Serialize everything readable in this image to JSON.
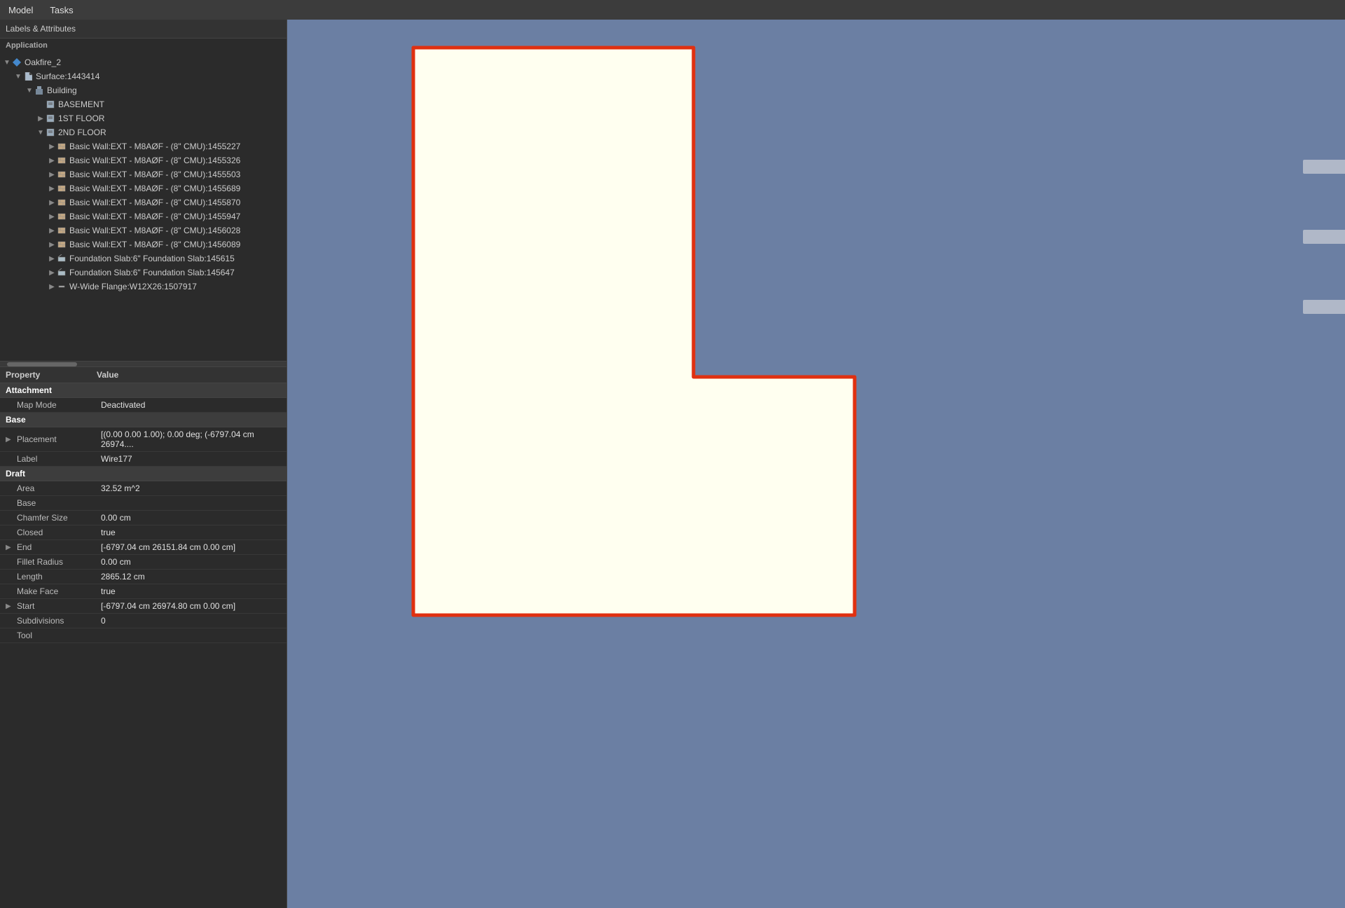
{
  "menubar": {
    "items": [
      "Model",
      "Tasks"
    ]
  },
  "panel": {
    "header": "Labels & Attributes",
    "section": "Application"
  },
  "tree": {
    "items": [
      {
        "id": "oakfire2",
        "label": "Oakfire_2",
        "indent": 0,
        "toggle": "▼",
        "icon": "🔷",
        "selected": false
      },
      {
        "id": "surface",
        "label": "Surface:1443414",
        "indent": 1,
        "toggle": "▼",
        "icon": "📄",
        "selected": false
      },
      {
        "id": "building",
        "label": "Building",
        "indent": 2,
        "toggle": "▼",
        "icon": "🏢",
        "selected": false
      },
      {
        "id": "basement",
        "label": "BASEMENT",
        "indent": 3,
        "toggle": " ",
        "icon": "📋",
        "selected": false
      },
      {
        "id": "1stfloor",
        "label": "1ST FLOOR",
        "indent": 3,
        "toggle": "▶",
        "icon": "📋",
        "selected": false
      },
      {
        "id": "2ndfloor",
        "label": "2ND FLOOR",
        "indent": 3,
        "toggle": "▼",
        "icon": "📋",
        "selected": false
      },
      {
        "id": "wall1",
        "label": "Basic Wall:EXT - M8AØF - (8\" CMU):1455227",
        "indent": 4,
        "toggle": "▶",
        "icon": "🧱",
        "selected": false
      },
      {
        "id": "wall2",
        "label": "Basic Wall:EXT - M8AØF - (8\" CMU):1455326",
        "indent": 4,
        "toggle": "▶",
        "icon": "🧱",
        "selected": false
      },
      {
        "id": "wall3",
        "label": "Basic Wall:EXT - M8AØF - (8\" CMU):1455503",
        "indent": 4,
        "toggle": "▶",
        "icon": "🧱",
        "selected": false
      },
      {
        "id": "wall4",
        "label": "Basic Wall:EXT - M8AØF - (8\" CMU):1455689",
        "indent": 4,
        "toggle": "▶",
        "icon": "🧱",
        "selected": false
      },
      {
        "id": "wall5",
        "label": "Basic Wall:EXT - M8AØF - (8\" CMU):1455870",
        "indent": 4,
        "toggle": "▶",
        "icon": "🧱",
        "selected": false
      },
      {
        "id": "wall6",
        "label": "Basic Wall:EXT - M8AØF - (8\" CMU):1455947",
        "indent": 4,
        "toggle": "▶",
        "icon": "🧱",
        "selected": false
      },
      {
        "id": "wall7",
        "label": "Basic Wall:EXT - M8AØF - (8\" CMU):1456028",
        "indent": 4,
        "toggle": "▶",
        "icon": "🧱",
        "selected": false
      },
      {
        "id": "wall8",
        "label": "Basic Wall:EXT - M8AØF - (8\" CMU):1456089",
        "indent": 4,
        "toggle": "▶",
        "icon": "🧱",
        "selected": false
      },
      {
        "id": "slab1",
        "label": "Foundation Slab:6\" Foundation Slab:145615",
        "indent": 4,
        "toggle": "▶",
        "icon": "🏗",
        "selected": false
      },
      {
        "id": "slab2",
        "label": "Foundation Slab:6\" Foundation Slab:145647",
        "indent": 4,
        "toggle": "▶",
        "icon": "🏗",
        "selected": false
      },
      {
        "id": "beam1",
        "label": "W-Wide Flange:W12X26:1507917",
        "indent": 4,
        "toggle": "▶",
        "icon": "🔩",
        "selected": false
      }
    ]
  },
  "properties": {
    "col_property": "Property",
    "col_value": "Value",
    "sections": [
      {
        "name": "Attachment",
        "rows": [
          {
            "name": "Map Mode",
            "value": "Deactivated",
            "toggle": ""
          }
        ]
      },
      {
        "name": "Base",
        "rows": [
          {
            "name": "Placement",
            "value": "[(0.00 0.00 1.00); 0.00 deg; (-6797.04 cm  26974....",
            "toggle": "▶"
          },
          {
            "name": "Label",
            "value": "Wire177",
            "toggle": ""
          }
        ]
      },
      {
        "name": "Draft",
        "rows": [
          {
            "name": "Area",
            "value": "32.52 m^2",
            "toggle": ""
          },
          {
            "name": "Base",
            "value": "",
            "toggle": ""
          },
          {
            "name": "Chamfer Size",
            "value": "0.00 cm",
            "toggle": ""
          },
          {
            "name": "Closed",
            "value": "true",
            "toggle": ""
          },
          {
            "name": "End",
            "value": "[-6797.04 cm  26151.84 cm  0.00 cm]",
            "toggle": "▶"
          },
          {
            "name": "Fillet Radius",
            "value": "0.00 cm",
            "toggle": ""
          },
          {
            "name": "Length",
            "value": "2865.12 cm",
            "toggle": ""
          },
          {
            "name": "Make Face",
            "value": "true",
            "toggle": ""
          },
          {
            "name": "Start",
            "value": "[-6797.04 cm  26974.80 cm  0.00 cm]",
            "toggle": "▶"
          },
          {
            "name": "Subdivisions",
            "value": "0",
            "toggle": ""
          },
          {
            "name": "Tool",
            "value": "",
            "toggle": ""
          }
        ]
      }
    ]
  },
  "viewport": {
    "background_color": "#6b7fa3"
  },
  "floor_plan": {
    "fill_color": "#fffff0",
    "stroke_color": "#e03010",
    "stroke_width": 4
  }
}
